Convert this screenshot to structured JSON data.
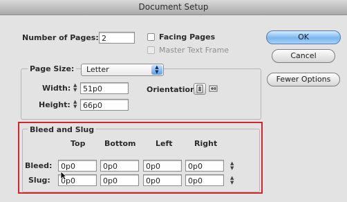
{
  "window": {
    "title": "Document Setup"
  },
  "pages": {
    "label": "Number of Pages:",
    "value": "2"
  },
  "options": {
    "facing_pages": "Facing Pages",
    "master_text_frame": "Master Text Frame"
  },
  "buttons": {
    "ok": "OK",
    "cancel": "Cancel",
    "fewer_options": "Fewer Options"
  },
  "page_size": {
    "label": "Page Size:",
    "selected": "Letter",
    "width_label": "Width:",
    "width": "51p0",
    "height_label": "Height:",
    "height": "66p0",
    "orientation_label": "Orientation:"
  },
  "bleed_slug": {
    "title": "Bleed and Slug",
    "headers": [
      "Top",
      "Bottom",
      "Left",
      "Right"
    ],
    "bleed_label": "Bleed:",
    "bleed": [
      "0p0",
      "0p0",
      "0p0",
      "0p0"
    ],
    "slug_label": "Slug:",
    "slug": [
      "0p0",
      "0p0",
      "0p0",
      "0p0"
    ]
  },
  "icons": {
    "portrait": "portrait-orientation-icon",
    "landscape": "landscape-orientation-icon",
    "link": "chain-link-icon",
    "stepper": "up-down-stepper-icon",
    "cursor": "mouse-pointer-icon"
  },
  "colors": {
    "highlight": "#d3222c",
    "default_button": "#7ab6ee"
  }
}
